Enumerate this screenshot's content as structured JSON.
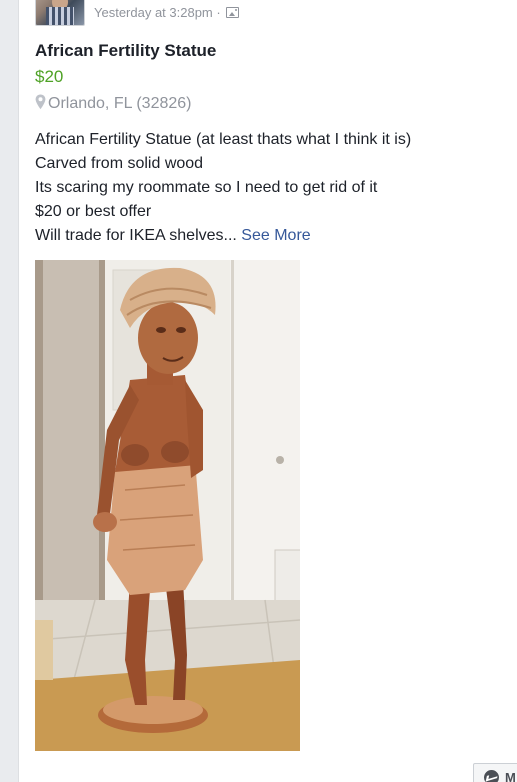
{
  "post": {
    "timestamp": "Yesterday at 3:28pm",
    "separator": "·",
    "audience_icon": "photo-icon"
  },
  "listing": {
    "title": "African Fertility Statue",
    "price": "$20",
    "location_icon": "map-pin-icon",
    "location": "Orlando, FL (32826)"
  },
  "description": {
    "lines": [
      "African Fertility Statue (at least thats what I think it is)",
      "Carved from solid wood",
      "Its scaring my roommate so I need to get rid of it",
      "$20 or best offer",
      "Will trade for IKEA shelves... "
    ],
    "see_more": "See More"
  },
  "messenger": {
    "icon": "messenger-icon",
    "label": "M"
  },
  "colors": {
    "price_green": "#4fa226",
    "link_blue": "#365899",
    "meta_gray": "#90949c",
    "text_dark": "#1d2129",
    "background": "#e9ebee"
  }
}
